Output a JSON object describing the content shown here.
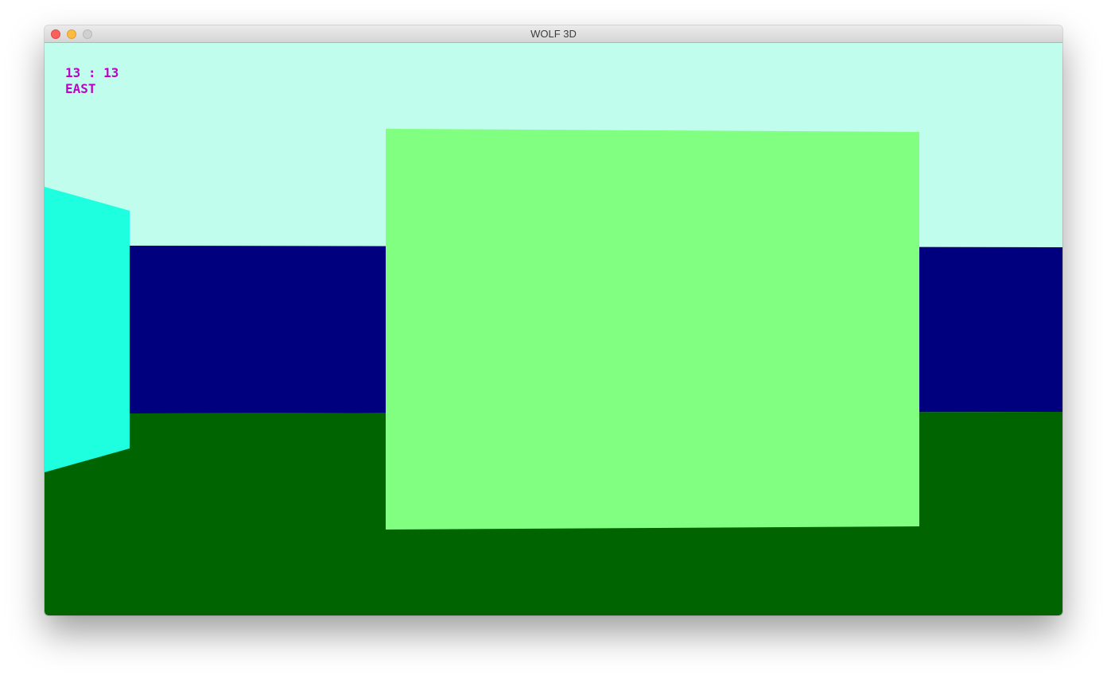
{
  "window": {
    "title": "WOLF 3D"
  },
  "hud": {
    "coordinates": "13 : 13",
    "direction": "EAST",
    "color": "#c000c8"
  },
  "scene": {
    "colors": {
      "sky": "#c0fdec",
      "far_wall": "#00007f",
      "floor": "#006400",
      "left_wall": "#1effe0",
      "front_wall": "#80ff80"
    }
  }
}
